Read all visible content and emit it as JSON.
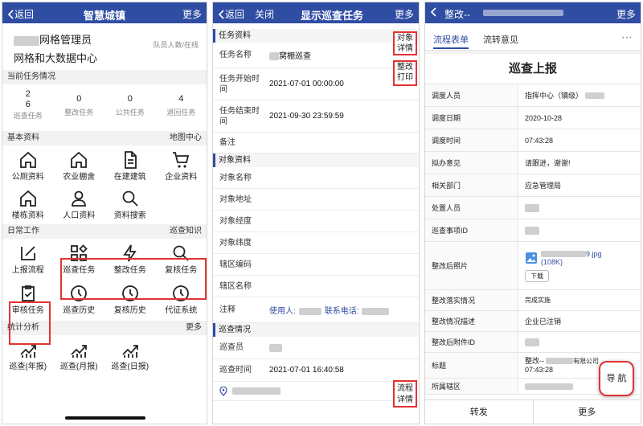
{
  "colors": {
    "nav": "#2f4da3",
    "highlight": "#e23333",
    "accent": "#2f4da3"
  },
  "p1": {
    "back": "返回",
    "title": "智慧城镇",
    "more": "更多",
    "role": "网格管理员",
    "role_sub": "网格和大数据中心",
    "team": "队员人数/在线",
    "current_section": "当前任务情况",
    "stats": [
      {
        "value": "2\n6",
        "label": "巡查任务"
      },
      {
        "value": "0",
        "label": "整改任务"
      },
      {
        "value": "0",
        "label": "公共任务"
      },
      {
        "value": "4",
        "label": "退回任务"
      }
    ],
    "basic_section": "基本资料",
    "map_center": "地图中心",
    "basic_items": [
      "公厕资料",
      "农业棚舍",
      "在建建筑",
      "企业资料",
      "楼栋资料",
      "人口资料",
      "资料搜索"
    ],
    "daily_section": "日常工作",
    "patrol_knowledge": "巡查知识",
    "daily_items": [
      "上报流程",
      "巡查任务",
      "整改任务",
      "复核任务",
      "审核任务",
      "巡查历史",
      "复核历史",
      "代征系统"
    ],
    "stats_section": "统计分析",
    "stats_more": "更多",
    "stats_items": [
      "巡查(年报)",
      "巡查(月报)",
      "巡查(日报)"
    ]
  },
  "p2": {
    "back": "返回",
    "close": "关闭",
    "title": "显示巡查任务",
    "more": "更多",
    "task_section": "任务资料",
    "task_rows": [
      {
        "label": "任务名称",
        "value": "窝棚巡查"
      },
      {
        "label": "任务开始时间",
        "value": "2021-07-01 00:00:00"
      },
      {
        "label": "任务结束时间",
        "value": "2021-09-30 23:59:59"
      },
      {
        "label": "备注",
        "value": ""
      }
    ],
    "btn_obj_detail": "对象\n详情",
    "btn_print": "整改\n打印",
    "object_section": "对象资料",
    "object_rows": [
      "对象名称",
      "对象地址",
      "对象经度",
      "对象纬度",
      "辖区编码",
      "辖区名称"
    ],
    "note_label": "注释",
    "note_user": "使用人:",
    "note_phone": "联系电话:",
    "patrol_section": "巡查情况",
    "patrol_rows": [
      {
        "label": "巡查员",
        "value": ""
      },
      {
        "label": "巡查时间",
        "value": "2021-07-01 16:40:58"
      }
    ],
    "btn_flow": "流程\n详情"
  },
  "p3": {
    "back": "",
    "title": "整改--",
    "more": "更多",
    "tabs": [
      "流程表单",
      "流转意见"
    ],
    "form_title": "巡查上报",
    "rows": [
      {
        "k": "调度人员",
        "v": "指挥中心（镇级）"
      },
      {
        "k": "调度日期",
        "v": "2020-10-28"
      },
      {
        "k": "调度时间",
        "v": "07:43:28"
      },
      {
        "k": "拟办意见",
        "v": "请跟进，谢谢!"
      },
      {
        "k": "相关部门",
        "v": "应急管理局"
      },
      {
        "k": "处置人员",
        "v": ""
      },
      {
        "k": "巡查事项ID",
        "v": ""
      },
      {
        "k": "整改后照片",
        "v": ""
      },
      {
        "k": "整改落实情况",
        "v": "完成实施"
      },
      {
        "k": "整改情况描述",
        "v": "企业已注销"
      },
      {
        "k": "整改后附件ID",
        "v": ""
      },
      {
        "k": "标题",
        "v": "整改--"
      },
      {
        "k": "所属辖区",
        "v": ""
      }
    ],
    "photo_name": "9.jpg",
    "photo_size": "(108K)",
    "download": "下载",
    "title_time": "07:43:28",
    "title_suffix": "有限公司",
    "nav_btn": "导 航",
    "footer": [
      "转发",
      "更多"
    ]
  }
}
